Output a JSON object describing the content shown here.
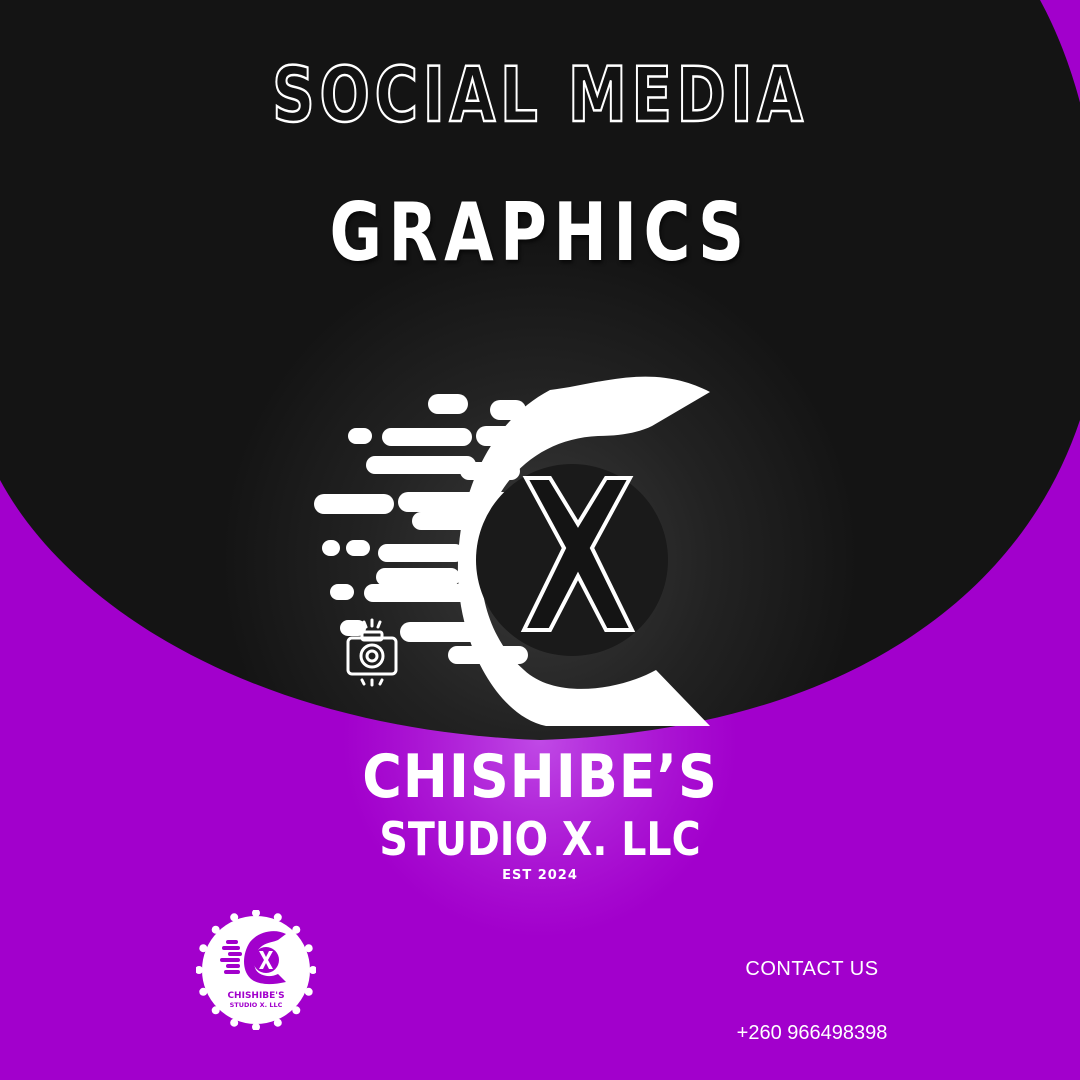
{
  "headline": {
    "line1": "SOCIAL MEDIA",
    "line2": "GRAPHICS"
  },
  "brand": {
    "name_line1": "CHISHIBE’S",
    "name_line2": "STUDIO X. LLC",
    "est": "EST 2024"
  },
  "badge": {
    "name_line1": "CHISHIBE'S",
    "name_line2": "STUDIO X. LLC"
  },
  "contact": {
    "title": "CONTACT US",
    "phone": "+260 966498398"
  },
  "colors": {
    "background_purple": "#a200cc",
    "dark": "#121212",
    "white": "#ffffff"
  },
  "icons": {
    "logo": "c-x-speed-logo-icon",
    "camera": "camera-icon",
    "badge": "round-badge-logo-icon"
  }
}
